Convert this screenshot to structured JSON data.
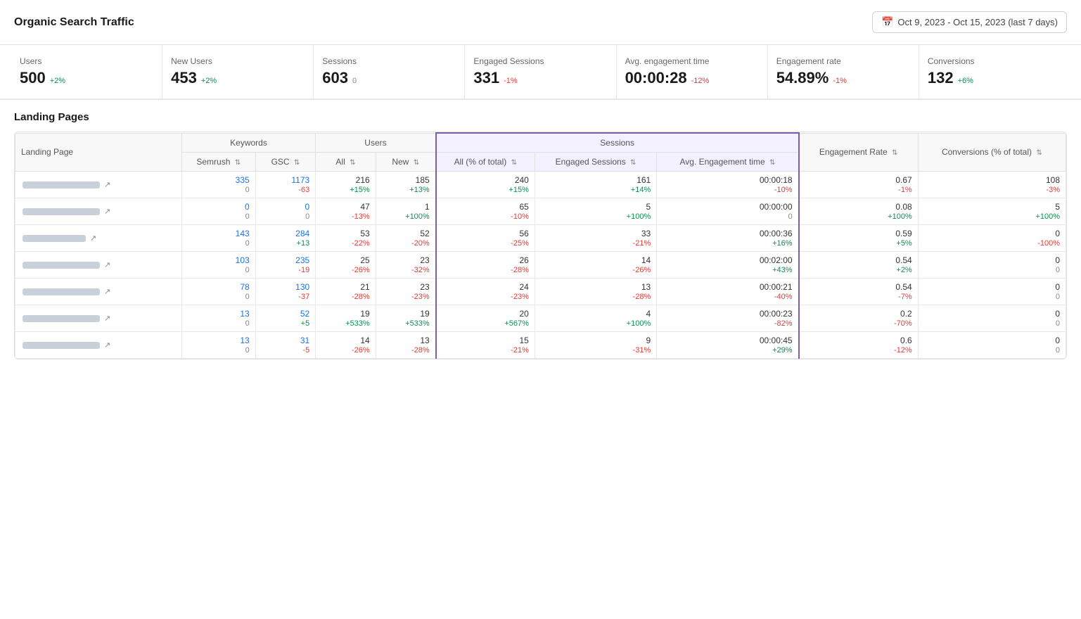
{
  "header": {
    "title": "Organic Search Traffic",
    "date_range": "Oct 9, 2023 - Oct 15, 2023 (last 7 days)"
  },
  "metrics": [
    {
      "label": "Users",
      "value": "500",
      "delta": "+2%",
      "delta_type": "pos"
    },
    {
      "label": "New Users",
      "value": "453",
      "delta": "+2%",
      "delta_type": "pos"
    },
    {
      "label": "Sessions",
      "value": "603",
      "delta": "0",
      "delta_type": "zero"
    },
    {
      "label": "Engaged Sessions",
      "value": "331",
      "delta": "-1%",
      "delta_type": "neg"
    },
    {
      "label": "Avg. engagement time",
      "value": "00:00:28",
      "delta": "-12%",
      "delta_type": "neg"
    },
    {
      "label": "Engagement rate",
      "value": "54.89%",
      "delta": "-1%",
      "delta_type": "neg"
    },
    {
      "label": "Conversions",
      "value": "132",
      "delta": "+6%",
      "delta_type": "pos"
    }
  ],
  "section_title": "Landing Pages",
  "table": {
    "group_headers": [
      {
        "label": "Landing Page",
        "rowspan": 2,
        "colspan": 1,
        "group": "landing"
      },
      {
        "label": "Keywords",
        "colspan": 2,
        "group": "keywords"
      },
      {
        "label": "Users",
        "colspan": 2,
        "group": "users"
      },
      {
        "label": "Sessions",
        "colspan": 3,
        "group": "sessions"
      },
      {
        "label": "Engagement Rate",
        "rowspan": 2,
        "colspan": 1,
        "group": "eng_rate"
      },
      {
        "label": "Conversions (% of total)",
        "rowspan": 2,
        "colspan": 1,
        "group": "conversions"
      }
    ],
    "sub_headers": [
      "Semrush",
      "GSC",
      "All",
      "New",
      "All (% of total)",
      "Engaged Sessions",
      "Avg. Engagement time"
    ],
    "rows": [
      {
        "page_width": "md",
        "semrush": "335",
        "semrush_delta": "0",
        "gsc": "1173",
        "gsc_delta": "-63",
        "users_all": "216",
        "users_all_delta": "+15%",
        "users_new": "185",
        "users_new_delta": "+13%",
        "sessions_all": "240",
        "sessions_all_delta": "+15%",
        "engaged": "161",
        "engaged_delta": "+14%",
        "avg_eng": "00:00:18",
        "avg_eng_delta": "-10%",
        "eng_rate": "0.67",
        "eng_rate_delta": "-1%",
        "conversions": "108",
        "conversions_delta": "-3%"
      },
      {
        "page_width": "md",
        "semrush": "0",
        "semrush_delta": "0",
        "gsc": "0",
        "gsc_delta": "0",
        "users_all": "47",
        "users_all_delta": "-13%",
        "users_new": "1",
        "users_new_delta": "+100%",
        "sessions_all": "65",
        "sessions_all_delta": "-10%",
        "engaged": "5",
        "engaged_delta": "+100%",
        "avg_eng": "00:00:00",
        "avg_eng_delta": "0",
        "eng_rate": "0.08",
        "eng_rate_delta": "+100%",
        "conversions": "5",
        "conversions_delta": "+100%"
      },
      {
        "page_width": "sm",
        "semrush": "143",
        "semrush_delta": "0",
        "gsc": "284",
        "gsc_delta": "+13",
        "users_all": "53",
        "users_all_delta": "-22%",
        "users_new": "52",
        "users_new_delta": "-20%",
        "sessions_all": "56",
        "sessions_all_delta": "-25%",
        "engaged": "33",
        "engaged_delta": "-21%",
        "avg_eng": "00:00:36",
        "avg_eng_delta": "+16%",
        "eng_rate": "0.59",
        "eng_rate_delta": "+5%",
        "conversions": "0",
        "conversions_delta": "-100%"
      },
      {
        "page_width": "md",
        "semrush": "103",
        "semrush_delta": "0",
        "gsc": "235",
        "gsc_delta": "-19",
        "users_all": "25",
        "users_all_delta": "-26%",
        "users_new": "23",
        "users_new_delta": "-32%",
        "sessions_all": "26",
        "sessions_all_delta": "-28%",
        "engaged": "14",
        "engaged_delta": "-26%",
        "avg_eng": "00:02:00",
        "avg_eng_delta": "+43%",
        "eng_rate": "0.54",
        "eng_rate_delta": "+2%",
        "conversions": "0",
        "conversions_delta": "0"
      },
      {
        "page_width": "md",
        "semrush": "78",
        "semrush_delta": "0",
        "gsc": "130",
        "gsc_delta": "-37",
        "users_all": "21",
        "users_all_delta": "-28%",
        "users_new": "23",
        "users_new_delta": "-23%",
        "sessions_all": "24",
        "sessions_all_delta": "-23%",
        "engaged": "13",
        "engaged_delta": "-28%",
        "avg_eng": "00:00:21",
        "avg_eng_delta": "-40%",
        "eng_rate": "0.54",
        "eng_rate_delta": "-7%",
        "conversions": "0",
        "conversions_delta": "0"
      },
      {
        "page_width": "md",
        "semrush": "13",
        "semrush_delta": "0",
        "gsc": "52",
        "gsc_delta": "+5",
        "users_all": "19",
        "users_all_delta": "+533%",
        "users_new": "19",
        "users_new_delta": "+533%",
        "sessions_all": "20",
        "sessions_all_delta": "+567%",
        "engaged": "4",
        "engaged_delta": "+100%",
        "avg_eng": "00:00:23",
        "avg_eng_delta": "-82%",
        "eng_rate": "0.2",
        "eng_rate_delta": "-70%",
        "conversions": "0",
        "conversions_delta": "0"
      },
      {
        "page_width": "md",
        "semrush": "13",
        "semrush_delta": "0",
        "gsc": "31",
        "gsc_delta": "-5",
        "users_all": "14",
        "users_all_delta": "-26%",
        "users_new": "13",
        "users_new_delta": "-28%",
        "sessions_all": "15",
        "sessions_all_delta": "-21%",
        "engaged": "9",
        "engaged_delta": "-31%",
        "avg_eng": "00:00:45",
        "avg_eng_delta": "+29%",
        "eng_rate": "0.6",
        "eng_rate_delta": "-12%",
        "conversions": "0",
        "conversions_delta": "0"
      }
    ]
  }
}
